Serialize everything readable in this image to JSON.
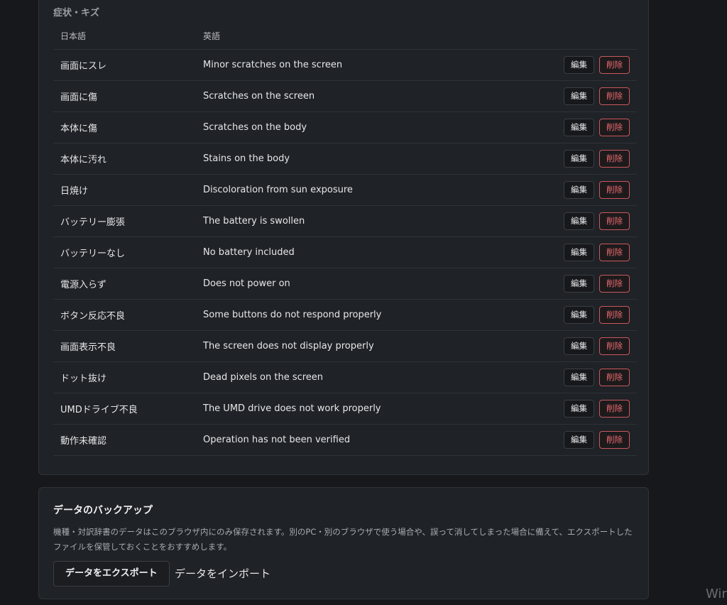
{
  "dictionary": {
    "section_title": "症状・キズ",
    "headers": {
      "japanese": "日本語",
      "english": "英語"
    },
    "actions": {
      "edit_label": "編集",
      "delete_label": "削除"
    },
    "rows": [
      {
        "ja": "画面にスレ",
        "en": "Minor scratches on the screen"
      },
      {
        "ja": "画面に傷",
        "en": "Scratches on the screen"
      },
      {
        "ja": "本体に傷",
        "en": "Scratches on the body"
      },
      {
        "ja": "本体に汚れ",
        "en": "Stains on the body"
      },
      {
        "ja": "日焼け",
        "en": "Discoloration from sun exposure"
      },
      {
        "ja": "バッテリー膨張",
        "en": "The battery is swollen"
      },
      {
        "ja": "バッテリーなし",
        "en": "No battery included"
      },
      {
        "ja": "電源入らず",
        "en": "Does not power on"
      },
      {
        "ja": "ボタン反応不良",
        "en": "Some buttons do not respond properly"
      },
      {
        "ja": "画面表示不良",
        "en": "The screen does not display properly"
      },
      {
        "ja": "ドット抜け",
        "en": "Dead pixels on the screen"
      },
      {
        "ja": "UMDドライブ不良",
        "en": "The UMD drive does not work properly"
      },
      {
        "ja": "動作未確認",
        "en": "Operation has not been verified"
      }
    ]
  },
  "backup": {
    "title": "データのバックアップ",
    "description": "機種・対訳辞書のデータはこのブラウザ内にのみ保存されます。別のPC・別のブラウザで使う場合や、誤って消してしまった場合に備えて、エクスポートしたファイルを保管しておくことをおすすめします。",
    "export_label": "データをエクスポート",
    "import_label": "データをインポート"
  },
  "os_watermark": "Wir",
  "colors": {
    "background": "#16181b",
    "panel": "#1f2226",
    "border": "#2f3338",
    "delete_accent": "#ea6b6f"
  }
}
